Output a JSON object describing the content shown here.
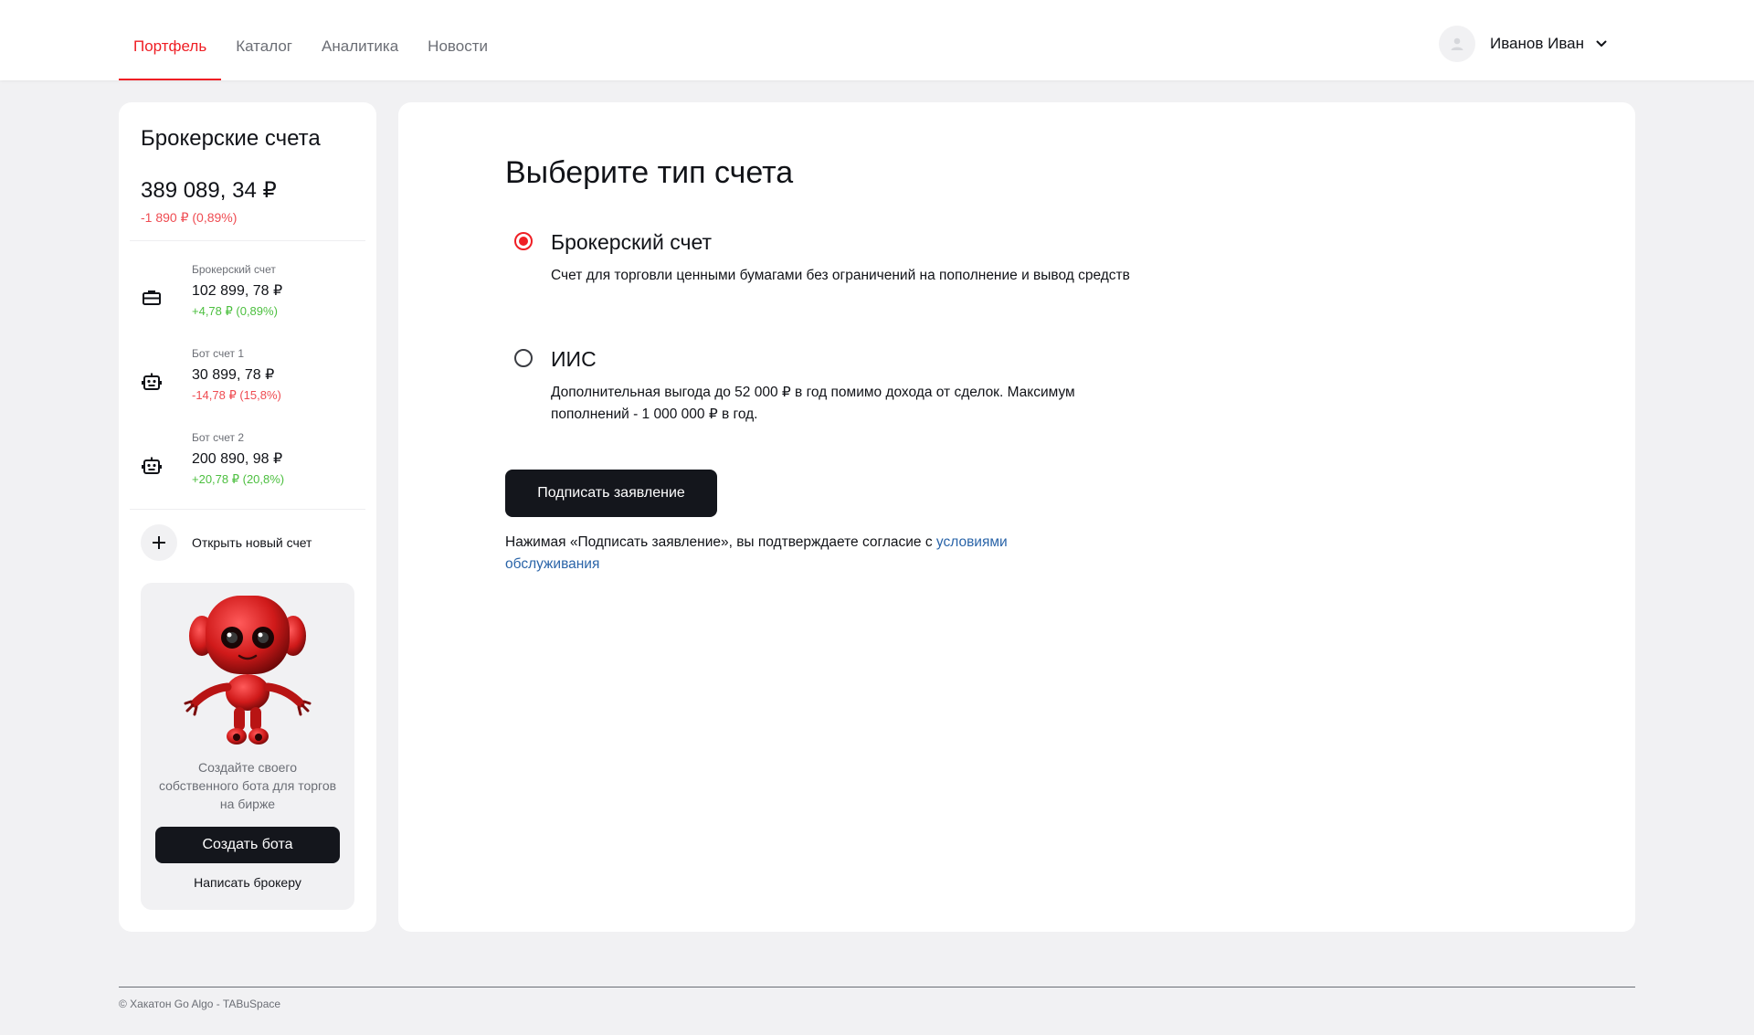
{
  "nav": {
    "tabs": [
      {
        "label": "Портфель"
      },
      {
        "label": "Каталог"
      },
      {
        "label": "Аналитика"
      },
      {
        "label": "Новости"
      }
    ]
  },
  "user": {
    "name": "Иванов Иван"
  },
  "sidebar": {
    "title": "Брокерские счета",
    "total": "389 089, 34 ₽",
    "total_change": "-1 890 ₽ (0,89%)",
    "accounts": [
      {
        "label": "Брокерский счет",
        "value": "102 899, 78 ₽",
        "change": "+4,78 ₽ (0,89%)",
        "icon": "briefcase-icon"
      },
      {
        "label": "Бот счет 1",
        "value": "30 899, 78 ₽",
        "change": "-14,78 ₽ (15,8%)",
        "icon": "robot-icon"
      },
      {
        "label": "Бот счет 2",
        "value": "200 890, 98 ₽",
        "change": "+20,78 ₽ (20,8%)",
        "icon": "robot-icon"
      }
    ],
    "open_account_label": "Открыть новый счет",
    "promo": {
      "text": "Создайте своего собственного бота для торгов на бирже",
      "create_button": "Создать бота",
      "write_broker": "Написать брокеру"
    }
  },
  "main": {
    "title": "Выберите тип счета",
    "options": [
      {
        "title": "Брокерский счет",
        "description": "Счет для торговли ценными бумагами без ограничений на пополнение и вывод средств",
        "selected": true
      },
      {
        "title": "ИИС",
        "description": "Дополнительная выгода до 52 000 ₽ в год помимо дохода от сделок. Максимум пополнений - 1 000 000 ₽ в год.",
        "selected": false
      }
    ],
    "sign_button": "Подписать заявление",
    "agree_text": "Нажимая «Подписать заявление», вы подтверждаете согласие с ",
    "agree_link": "условиями обслуживания"
  },
  "footer": {
    "text": "© Хакатон Go Algo - TABuSpace"
  },
  "colors": {
    "accent": "#ef1e24",
    "positive": "#4cbf3f",
    "negative": "#ef4c52",
    "link": "#2a64a8",
    "button": "#14161c"
  }
}
